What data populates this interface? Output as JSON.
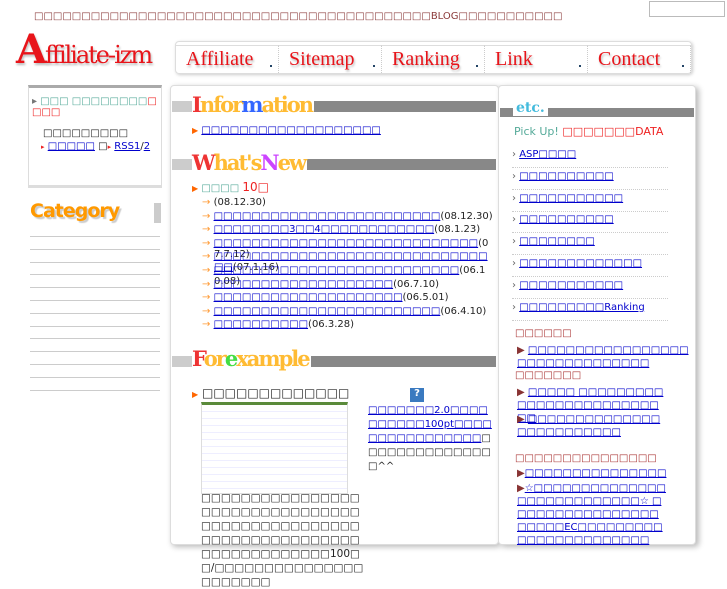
{
  "header": {
    "tagline": "□□□□□□□□□□□□□□□□□□□□□□□□□□□□□□□□□□□□□□□□□□BLOG□□□□□□□□□□□",
    "logo": "Affiliate-izm"
  },
  "nav": [
    "Affiliate",
    "Sitemap",
    "Ranking",
    "Link",
    "Contact"
  ],
  "left": {
    "title_green": "□□□ □□□□□□□□",
    "title_red": "□□□□",
    "subtitle": "□□□□□□□□□",
    "link1": "□□□□□",
    "sep": "□",
    "rss": "RSS1",
    "slash": "/",
    "rss2": "2",
    "category": "Category"
  },
  "info": {
    "heading": "Information",
    "item": "□□□□□□□□□□□□□□□□□□□"
  },
  "news": {
    "heading": "What's New",
    "label": "□□□□",
    "count": "10□",
    "items": [
      {
        "t": "",
        "d": "(08.12.30)"
      },
      {
        "t": "□□□□□□□□□□□□□□□□□□□□□□□□",
        "d": "(08.12.30)"
      },
      {
        "t": "□□□□□□□□3□□4□□□□□□□□□□□□",
        "d": "(08.1.23)"
      },
      {
        "t": "□□□□□□□□□□□□□□□□□□□□□□□□□□□□",
        "d": "(07.7.12)"
      },
      {
        "t": "□□□□□□□□□□□□□□□□□□□□□□□□□□□□□□□",
        "d": "(07.1.16)"
      },
      {
        "t": "□□□□□□□□□□□□□□□□□□□□□□□□□□",
        "d": "(06.10.08)"
      },
      {
        "t": "□□□□□□□□□□□□□□□□□□□",
        "d": "(06.7.10)"
      },
      {
        "t": "□□□□□□□□□□□□□□□□□□□□",
        "d": "(06.5.01)"
      },
      {
        "t": "□□□□□□□□□□□□□□□□□□□□□□□□",
        "d": "(06.4.10)"
      },
      {
        "t": "□□□□□□□□□□",
        "d": "(06.3.28)"
      }
    ]
  },
  "example": {
    "heading": "For example",
    "title": "□□□□□□□□□□□□□",
    "body": "□□□□□□□□□□□□□□□□□□□□□□□□□□□□□□□□□□□□□□□□□□□□□□□□□□□□□□□□□□□□□□□□□□□□□□□□□□□□□100□□/□□□□□□□□□□□□□□□□□□□□□□",
    "side_link": "□□□□□□□2.0□□□□□□□□□□100pt□□□□□□□□□□□□□□□□",
    "side_text": "□□□□□□□□□□□□□□□^^"
  },
  "right": {
    "heading": "etc.",
    "pick": "Pick Up!",
    "pick_red": "□□□□□□□DATA",
    "links": [
      "ASP□□□□",
      "□□□□□□□□□□",
      "□□□□□□□□□□□",
      "□□□□□□□□□□",
      "□□□□□□□□",
      "□□□□□□□□□□□□□",
      "□□□□□□□□□□□",
      "□□□□□□□□□Ranking"
    ],
    "h1": "□□□□□□",
    "l1": "□□□□□□□□□□□□□□□□□□□□□□□□□□□□□□□",
    "h2": "□□□□□□□",
    "l2": "□□□□□ □□□□□□□□□□□□□□□□□□□□□□□□□□",
    "l3": "□□□□□□□□□□□□□□□□□□□□□□□□□",
    "h3": "□□□□□□□□□□□□□□□",
    "l4": "□□□□□□□□□□□□□□□",
    "l5": "☆□□□□□□□□□□□□□□□□□□□□□□□□□□□☆ □□□□□□□□□□□□□□□□□□□□□EC□□□□□□□□□□□□□□□□□□□□□□□"
  }
}
